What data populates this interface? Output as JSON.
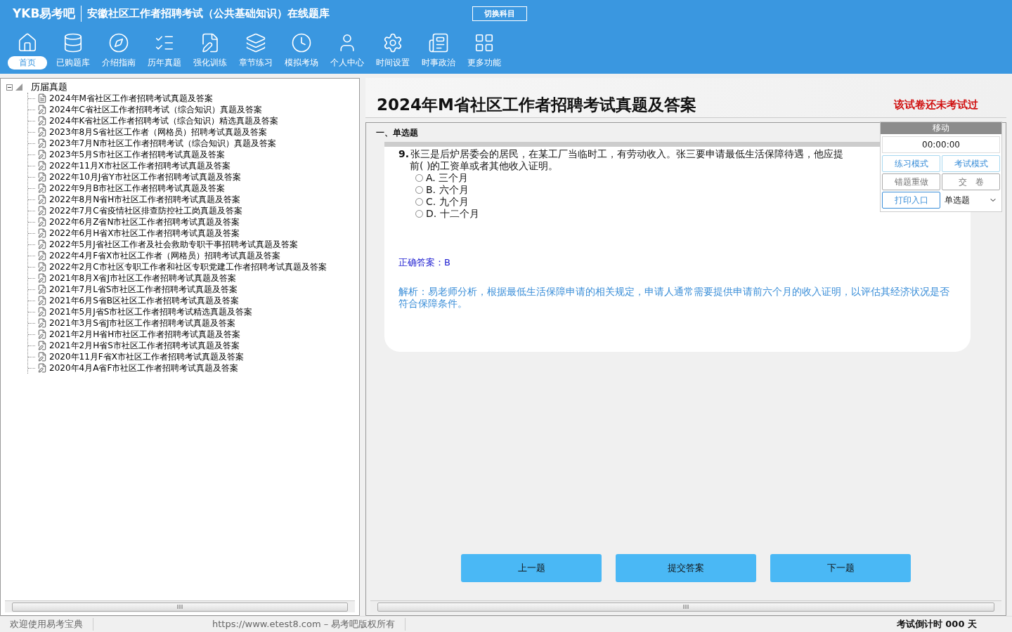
{
  "app": {
    "logo": "YKB易考吧",
    "title": "安徽社区工作者招聘考试（公共基础知识）在线题库",
    "switch_button": "切换科目"
  },
  "toolbar": [
    {
      "label": "首页",
      "selected": true
    },
    {
      "label": "已购题库",
      "selected": false
    },
    {
      "label": "介绍指南",
      "selected": false
    },
    {
      "label": "历年真题",
      "selected": false
    },
    {
      "label": "强化训练",
      "selected": false
    },
    {
      "label": "章节练习",
      "selected": false
    },
    {
      "label": "模拟考场",
      "selected": false
    },
    {
      "label": "个人中心",
      "selected": false
    },
    {
      "label": "时间设置",
      "selected": false
    },
    {
      "label": "时事政治",
      "selected": false
    },
    {
      "label": "更多功能",
      "selected": false
    }
  ],
  "tree": {
    "label": "历届真题",
    "expanded": true,
    "children": [
      {
        "label": "2024年M省社区工作者招聘考试真题及答案",
        "kind": "current"
      },
      {
        "label": "2024年C省社区工作者招聘考试（综合知识）真题及答案",
        "kind": "paper"
      },
      {
        "label": "2024年K省社区工作者招聘考试（综合知识）精选真题及答案",
        "kind": "paper"
      },
      {
        "label": "2023年8月S省社区工作者（网格员）招聘考试真题及答案",
        "kind": "paper"
      },
      {
        "label": "2023年7月N市社区工作者招聘考试（综合知识）真题及答案",
        "kind": "paper"
      },
      {
        "label": "2023年5月S市社区工作者招聘考试真题及答案",
        "kind": "paper"
      },
      {
        "label": "2022年11月X市社区工作者招聘考试真题及答案",
        "kind": "paper"
      },
      {
        "label": "2022年10月J省Y市社区工作者招聘考试真题及答案",
        "kind": "paper"
      },
      {
        "label": "2022年9月B市社区工作者招聘考试真题及答案",
        "kind": "paper"
      },
      {
        "label": "2022年8月N省H市社区工作者招聘考试真题及答案",
        "kind": "paper"
      },
      {
        "label": "2022年7月C省疫情社区排查防控社工岗真题及答案",
        "kind": "paper"
      },
      {
        "label": "2022年6月Z省N市社区工作者招聘考试真题及答案",
        "kind": "paper"
      },
      {
        "label": "2022年6月H省X市社区工作者招聘考试真题及答案",
        "kind": "paper"
      },
      {
        "label": "2022年5月J省社区工作者及社会救助专职干事招聘考试真题及答案",
        "kind": "paper"
      },
      {
        "label": "2022年4月F省X市社区工作者（网格员）招聘考试真题及答案",
        "kind": "paper"
      },
      {
        "label": "2022年2月C市社区专职工作者和社区专职党建工作者招聘考试真题及答案",
        "kind": "paper"
      },
      {
        "label": "2021年8月X省J市社区工作者招聘考试真题及答案",
        "kind": "paper"
      },
      {
        "label": "2021年7月L省S市社区工作者招聘考试真题及答案",
        "kind": "paper"
      },
      {
        "label": "2021年6月S省B区社区工作者招聘考试真题及答案",
        "kind": "paper"
      },
      {
        "label": "2021年5月J省S市社区工作者招聘考试精选真题及答案",
        "kind": "paper"
      },
      {
        "label": "2021年3月S省J市社区工作者招聘考试真题及答案",
        "kind": "paper"
      },
      {
        "label": "2021年2月H省H市社区工作者招聘考试真题及答案",
        "kind": "paper"
      },
      {
        "label": "2021年2月H省S市社区工作者招聘考试真题及答案",
        "kind": "paper"
      },
      {
        "label": "2020年11月F省X市社区工作者招聘考试真题及答案",
        "kind": "paper"
      },
      {
        "label": "2020年4月A省F市社区工作者招聘考试真题及答案",
        "kind": "paper"
      }
    ]
  },
  "paper": {
    "title": "2024年M省社区工作者招聘考试真题及答案",
    "status": "该试卷还未考试过",
    "section": "一、单选题"
  },
  "question": {
    "number": "9.",
    "lines": [
      "张三是后炉居委会的居民，在某工厂当临时工，有劳动收入。张三要申请最低生活保障待遇，他应提",
      "前( )的工资单或者其他收入证明。"
    ],
    "options": [
      {
        "label": "A. 三个月",
        "selected": false
      },
      {
        "label": "B. 六个月",
        "selected": false
      },
      {
        "label": "C. 九个月",
        "selected": false
      },
      {
        "label": "D. 十二个月",
        "selected": false
      }
    ],
    "answer": "正确答案：B",
    "analysis": "解析：易老师分析，根据最低生活保障申请的相关规定，申请人通常需要提供申请前六个月的收入证明，以评估其经济状况是否符合保障条件。"
  },
  "panel": {
    "header": "移动",
    "timer": "00:00:00",
    "buttons": [
      {
        "label": "练习模式",
        "disabled": false
      },
      {
        "label": "考试模式",
        "disabled": false
      },
      {
        "label": "错题重做",
        "disabled": true
      },
      {
        "label": "交　卷",
        "disabled": true
      },
      {
        "label": "打印入口",
        "disabled": false
      }
    ],
    "type_select": "单选题"
  },
  "nav_buttons": [
    "上一题",
    "提交答案",
    "下一题"
  ],
  "status_bar": {
    "welcome": "欢迎使用易考宝典",
    "copyright": "https://www.etest8.com – 易考吧版权所有",
    "countdown": "考试倒计时 000 天"
  }
}
